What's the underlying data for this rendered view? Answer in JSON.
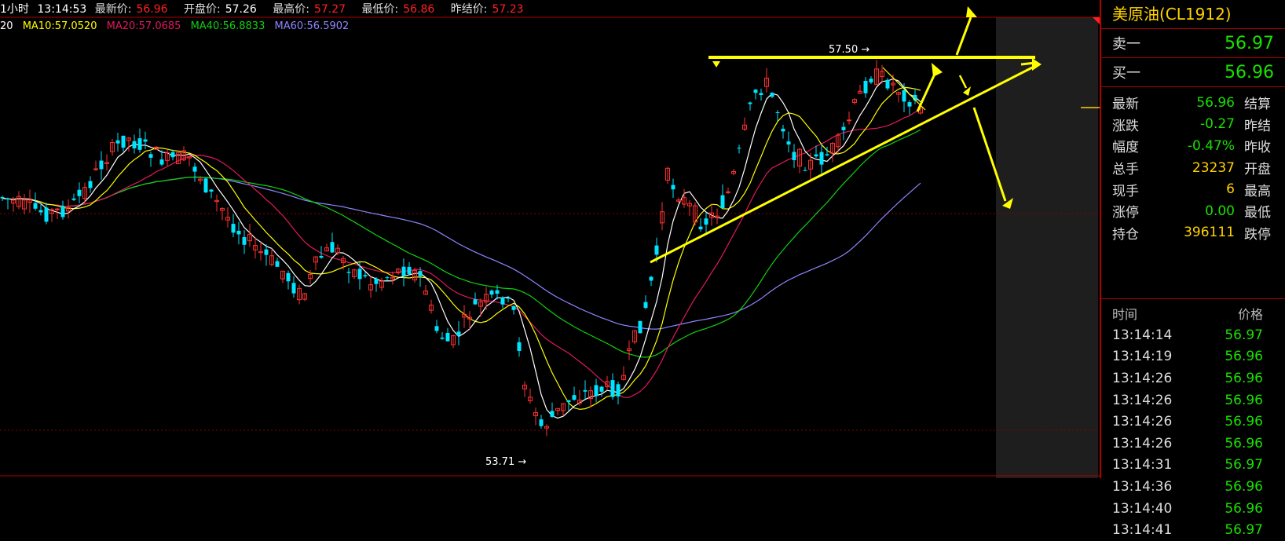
{
  "header": {
    "period": "1小时",
    "time": "13:14:53",
    "fields": [
      {
        "label": "最新价:",
        "value": "56.96"
      },
      {
        "label": "开盘价:",
        "value": "57.26"
      },
      {
        "label": "最高价:",
        "value": "57.27"
      },
      {
        "label": "最低价:",
        "value": "56.86"
      },
      {
        "label": "昨结价:",
        "value": "57.23"
      }
    ]
  },
  "ma_legend": [
    {
      "text": "20",
      "color": "#ffffff"
    },
    {
      "text": "MA10:57.0520",
      "color": "#ffff00"
    },
    {
      "text": "MA20:57.0685",
      "color": "#e0195a"
    },
    {
      "text": "MA40:56.8833",
      "color": "#10d010"
    },
    {
      "text": "MA60:56.5902",
      "color": "#8c86ff"
    }
  ],
  "chart_labels": {
    "high_label": "57.50",
    "low_label": "53.71"
  },
  "colors": {
    "up": "#ff3030",
    "down": "#00e5ff",
    "ma5": "#ffffff",
    "ma10": "#ffff00",
    "ma20": "#e0195a",
    "ma40": "#10d010",
    "ma60": "#8c86ff",
    "annotation": "#ffff00",
    "grid": "#8a0000",
    "accent": "#ffd200",
    "price_green": "#19e000"
  },
  "sidebar": {
    "title": "美原油(CL1912)",
    "sell_label": "卖一",
    "sell_value": "56.97",
    "buy_label": "买一",
    "buy_value": "56.96",
    "stats": [
      {
        "k": "最新",
        "v": "56.96",
        "vc": "#19e000",
        "k2": "结算"
      },
      {
        "k": "涨跌",
        "v": "-0.27",
        "vc": "#19e000",
        "k2": "昨结"
      },
      {
        "k": "幅度",
        "v": "-0.47%",
        "vc": "#19e000",
        "k2": "昨收"
      },
      {
        "k": "总手",
        "v": "23237",
        "vc": "#ffd200",
        "k2": "开盘"
      },
      {
        "k": "现手",
        "v": "6",
        "vc": "#ffd200",
        "k2": "最高"
      },
      {
        "k": "涨停",
        "v": "0.00",
        "vc": "#19e000",
        "k2": "最低"
      },
      {
        "k": "持仓",
        "v": "396111",
        "vc": "#ffd200",
        "k2": "跌停"
      }
    ],
    "tick_header": {
      "time": "时间",
      "price": "价格"
    },
    "ticks": [
      {
        "t": "13:14:14",
        "p": "56.97"
      },
      {
        "t": "13:14:19",
        "p": "56.96"
      },
      {
        "t": "13:14:26",
        "p": "56.96"
      },
      {
        "t": "13:14:26",
        "p": "56.96"
      },
      {
        "t": "13:14:26",
        "p": "56.96"
      },
      {
        "t": "13:14:26",
        "p": "56.96"
      },
      {
        "t": "13:14:31",
        "p": "56.97"
      },
      {
        "t": "13:14:36",
        "p": "56.96"
      },
      {
        "t": "13:14:40",
        "p": "56.96"
      },
      {
        "t": "13:14:41",
        "p": "56.97"
      }
    ]
  }
}
